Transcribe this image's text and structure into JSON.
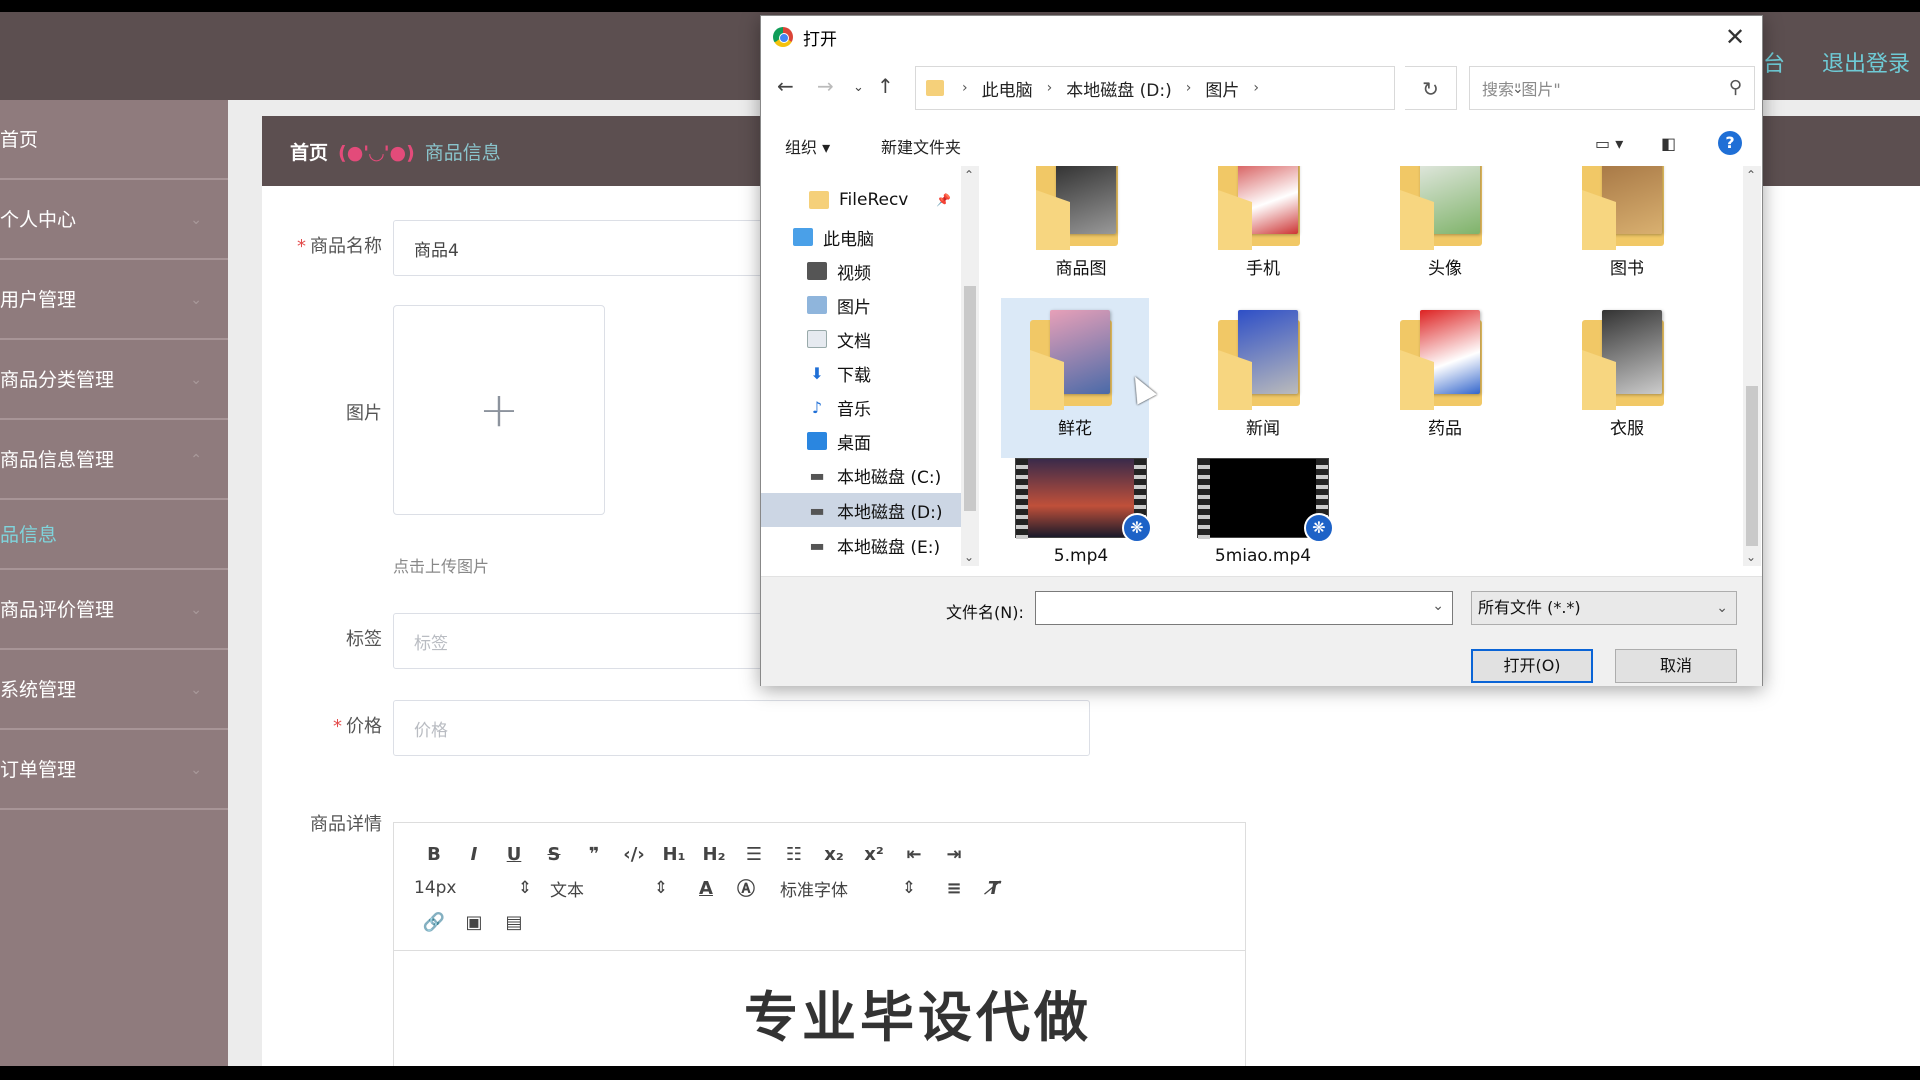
{
  "topbar": {
    "nav_right": [
      "台",
      "退出登录"
    ]
  },
  "sidebar": {
    "items": [
      {
        "label": "首页"
      },
      {
        "label": "个人中心"
      },
      {
        "label": "用户管理"
      },
      {
        "label": "商品分类管理"
      },
      {
        "label": "商品信息管理"
      },
      {
        "label": "品信息"
      },
      {
        "label": "商品评价管理"
      },
      {
        "label": "系统管理"
      },
      {
        "label": "订单管理"
      }
    ]
  },
  "breadcrumb": {
    "home": "首页",
    "face": "(●'◡'●)",
    "current": "商品信息"
  },
  "form": {
    "name_label": "商品名称",
    "name_value": "商品4",
    "image_label": "图片",
    "upload_hint": "点击上传图片",
    "tag_label": "标签",
    "tag_placeholder": "标签",
    "price_label": "价格",
    "price_placeholder": "价格",
    "detail_label": "商品详情"
  },
  "editor": {
    "font_size": "14px",
    "block_type": "文本",
    "font_family": "标准字体",
    "body_text": "专业毕设代做"
  },
  "dialog": {
    "title": "打开",
    "path": [
      "此电脑",
      "本地磁盘 (D:)",
      "图片"
    ],
    "search_placeholder": "搜索\"图片\"",
    "organize": "组织",
    "new_folder": "新建文件夹",
    "tree": [
      {
        "label": "FileRecv"
      },
      {
        "label": "此电脑"
      },
      {
        "label": "视频"
      },
      {
        "label": "图片"
      },
      {
        "label": "文档"
      },
      {
        "label": "下载"
      },
      {
        "label": "音乐"
      },
      {
        "label": "桌面"
      },
      {
        "label": "本地磁盘 (C:)"
      },
      {
        "label": "本地磁盘 (D:)"
      },
      {
        "label": "本地磁盘 (E:)"
      }
    ],
    "files": [
      {
        "label": "商品图"
      },
      {
        "label": "手机"
      },
      {
        "label": "头像"
      },
      {
        "label": "图书"
      },
      {
        "label": "鲜花"
      },
      {
        "label": "新闻"
      },
      {
        "label": "药品"
      },
      {
        "label": "衣服"
      },
      {
        "label": "5.mp4"
      },
      {
        "label": "5miao.mp4"
      }
    ],
    "filename_label": "文件名(N):",
    "filename_value": "",
    "filetype": "所有文件 (*.*)",
    "open_button": "打开(O)",
    "cancel_button": "取消"
  },
  "colors": {
    "topbar": "#5c4f50",
    "sidebar": "#8f7b7d",
    "accent_teal": "#6ecbd6",
    "dialog_primary_border": "#0a64d6"
  }
}
